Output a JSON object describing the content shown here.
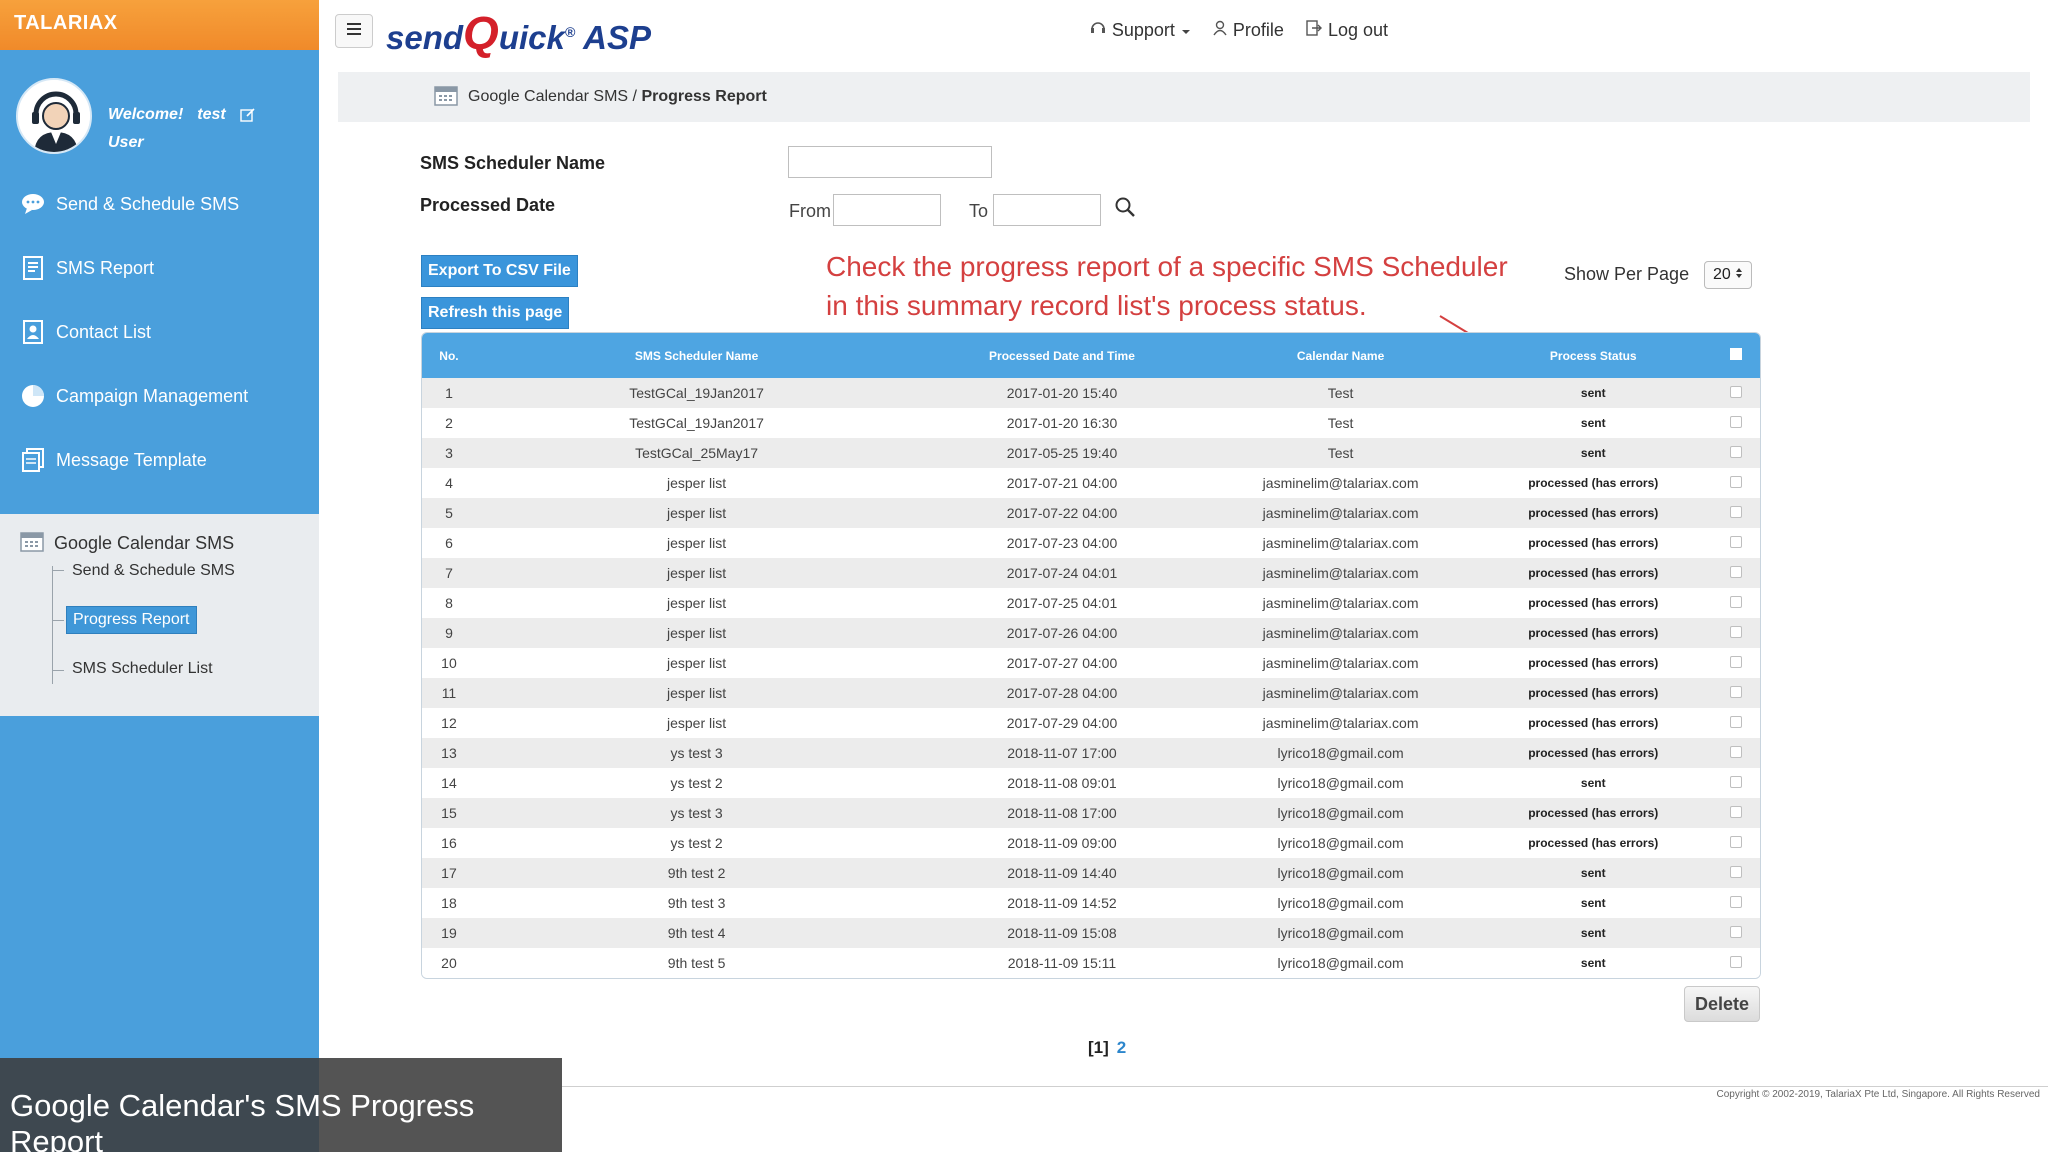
{
  "brand": "TALARIAX",
  "user": {
    "welcome": "Welcome!",
    "username": "test",
    "role": "User"
  },
  "sidebar": {
    "items": [
      {
        "label": "Send & Schedule SMS",
        "icon": "chat-bubble-icon"
      },
      {
        "label": "SMS Report",
        "icon": "report-icon"
      },
      {
        "label": "Contact List",
        "icon": "contact-icon"
      },
      {
        "label": "Campaign Management",
        "icon": "pie-chart-icon"
      },
      {
        "label": "Message Template",
        "icon": "template-icon"
      }
    ],
    "section": {
      "title": "Google Calendar SMS",
      "children": [
        {
          "label": "Send & Schedule SMS"
        },
        {
          "label": "Progress Report",
          "active": true
        },
        {
          "label": "SMS Scheduler List"
        }
      ]
    }
  },
  "header": {
    "logo_prefix": "send",
    "logo_q": "Q",
    "logo_suffix": "uick",
    "logo_reg": "®",
    "logo_asp": "ASP",
    "support": "Support",
    "profile": "Profile",
    "logout": "Log out"
  },
  "breadcrumb": {
    "parent": "Google Calendar SMS",
    "separator": "/",
    "current": "Progress Report"
  },
  "filters": {
    "scheduler_name_label": "SMS Scheduler Name",
    "processed_date_label": "Processed Date",
    "from_label": "From",
    "to_label": "To",
    "scheduler_name_value": "",
    "from_value": "",
    "to_value": ""
  },
  "buttons": {
    "export": "Export To CSV File",
    "refresh": "Refresh this page",
    "delete": "Delete"
  },
  "annotation": {
    "line1": "Check the progress report of a specific SMS Scheduler",
    "line2": "in this summary record list's process status."
  },
  "show_per_page": {
    "label": "Show Per Page",
    "value": "20"
  },
  "table": {
    "headers": [
      "No.",
      "SMS Scheduler Name",
      "Processed Date and Time",
      "Calendar Name",
      "Process Status"
    ],
    "rows": [
      [
        "1",
        "TestGCal_19Jan2017",
        "2017-01-20 15:40",
        "Test",
        "sent"
      ],
      [
        "2",
        "TestGCal_19Jan2017",
        "2017-01-20 16:30",
        "Test",
        "sent"
      ],
      [
        "3",
        "TestGCal_25May17",
        "2017-05-25 19:40",
        "Test",
        "sent"
      ],
      [
        "4",
        "jesper list",
        "2017-07-21 04:00",
        "jasminelim@talariax.com",
        "processed (has errors)"
      ],
      [
        "5",
        "jesper list",
        "2017-07-22 04:00",
        "jasminelim@talariax.com",
        "processed (has errors)"
      ],
      [
        "6",
        "jesper list",
        "2017-07-23 04:00",
        "jasminelim@talariax.com",
        "processed (has errors)"
      ],
      [
        "7",
        "jesper list",
        "2017-07-24 04:01",
        "jasminelim@talariax.com",
        "processed (has errors)"
      ],
      [
        "8",
        "jesper list",
        "2017-07-25 04:01",
        "jasminelim@talariax.com",
        "processed (has errors)"
      ],
      [
        "9",
        "jesper list",
        "2017-07-26 04:00",
        "jasminelim@talariax.com",
        "processed (has errors)"
      ],
      [
        "10",
        "jesper list",
        "2017-07-27 04:00",
        "jasminelim@talariax.com",
        "processed (has errors)"
      ],
      [
        "11",
        "jesper list",
        "2017-07-28 04:00",
        "jasminelim@talariax.com",
        "processed (has errors)"
      ],
      [
        "12",
        "jesper list",
        "2017-07-29 04:00",
        "jasminelim@talariax.com",
        "processed (has errors)"
      ],
      [
        "13",
        "ys test 3",
        "2018-11-07 17:00",
        "lyrico18@gmail.com",
        "processed (has errors)"
      ],
      [
        "14",
        "ys test 2",
        "2018-11-08 09:01",
        "lyrico18@gmail.com",
        "sent"
      ],
      [
        "15",
        "ys test 3",
        "2018-11-08 17:00",
        "lyrico18@gmail.com",
        "processed (has errors)"
      ],
      [
        "16",
        "ys test 2",
        "2018-11-09 09:00",
        "lyrico18@gmail.com",
        "processed (has errors)"
      ],
      [
        "17",
        "9th test 2",
        "2018-11-09 14:40",
        "lyrico18@gmail.com",
        "sent"
      ],
      [
        "18",
        "9th test 3",
        "2018-11-09 14:52",
        "lyrico18@gmail.com",
        "sent"
      ],
      [
        "19",
        "9th test 4",
        "2018-11-09 15:08",
        "lyrico18@gmail.com",
        "sent"
      ],
      [
        "20",
        "9th test 5",
        "2018-11-09 15:11",
        "lyrico18@gmail.com",
        "sent"
      ]
    ]
  },
  "pagination": {
    "current": "[1]",
    "next": "2"
  },
  "footer": {
    "copyright": "Copyright © 2002-2019, TalariaX Pte Ltd, Singapore. All Rights Reserved"
  },
  "caption": "Google Calendar's SMS Progress Report",
  "colors": {
    "sidebar": "#4a9fdc",
    "brand_orange": "#f08a2a",
    "table_header": "#4ea5e2",
    "annotation_red": "#d44040"
  }
}
